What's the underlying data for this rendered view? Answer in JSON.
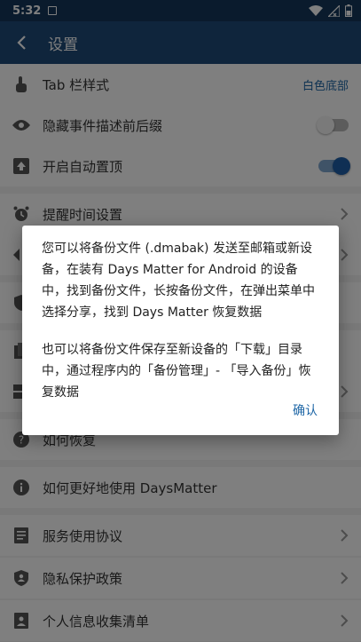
{
  "status_bar": {
    "time": "5:32"
  },
  "app_bar": {
    "title": "设置"
  },
  "settings": {
    "tab_style": {
      "label": "Tab 栏样式",
      "value": "白色底部"
    },
    "hide_desc": {
      "label": "隐藏事件描述前后缀",
      "enabled": false
    },
    "auto_pin": {
      "label": "开启自动置顶",
      "enabled": true
    },
    "reminder_time": {
      "label": "提醒时间设置"
    },
    "how_restore": {
      "label": "如何恢复"
    },
    "how_use": {
      "label": "如何更好地使用 DaysMatter"
    },
    "terms": {
      "label": "服务使用协议"
    },
    "privacy": {
      "label": "隐私保护政策"
    },
    "personal_info": {
      "label": "个人信息收集清单"
    }
  },
  "dialog": {
    "paragraph_1": "您可以将备份文件 (.dmabak) 发送至邮箱或新设备，在装有 Days Matter for Android 的设备中，找到备份文件，长按备份文件，在弹出菜单中选择分享，找到 Days Matter 恢复数据",
    "paragraph_2": "也可以将备份文件保存至新设备的「下载」目录中，通过程序内的「备份管理」- 「导入备份」恢复数据",
    "confirm_label": "确认"
  },
  "colors": {
    "primary": "#1f4b78",
    "status_bar": "#14375a",
    "accent": "#1e66a6"
  }
}
